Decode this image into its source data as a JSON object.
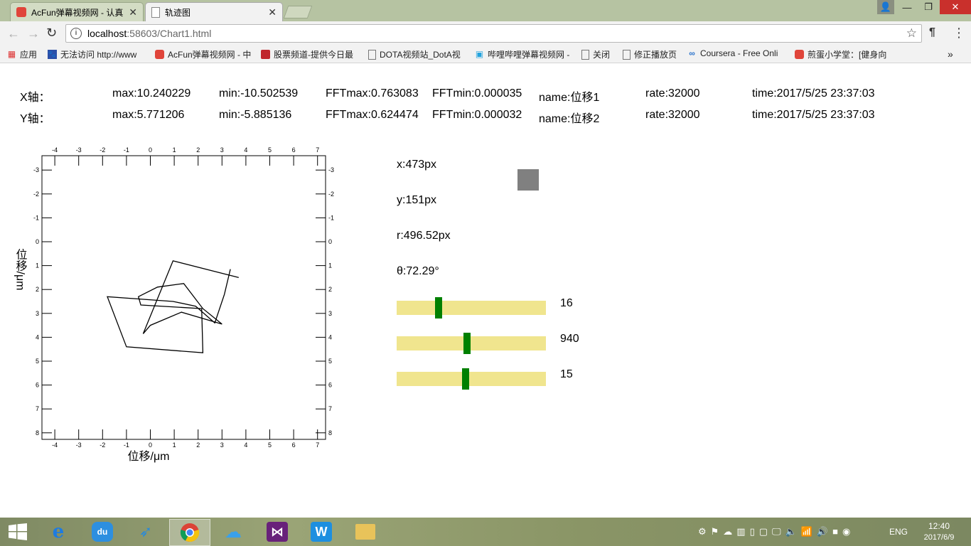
{
  "browser": {
    "tabs": [
      {
        "title": "AcFun弹幕视频网 - 认真"
      },
      {
        "title": "轨迹图"
      }
    ],
    "url_host": "localhost",
    "url_rest": ":58603/Chart1.html",
    "bookmarks": [
      "应用",
      "无法访问 http://www",
      "AcFun弹幕视频网 - 中",
      "股票频道-提供今日最",
      "DOTA视频站_DotA视",
      "哔哩哔哩弹幕视频网 -",
      "关闭",
      "修正播放页",
      "Coursera - Free Onli",
      "煎蛋小学堂：[健身向"
    ],
    "more_bookmarks": "»"
  },
  "info": {
    "x_row": {
      "label": "X轴：",
      "max": "max:10.240229",
      "min": "min:-10.502539",
      "fftmax": "FFTmax:0.763083",
      "fftmin": "FFTmin:0.000035",
      "name": "name:位移1",
      "rate": "rate:32000",
      "time": "time:2017/5/25 23:37:03"
    },
    "y_row": {
      "label": "Y轴：",
      "max": "max:5.771206",
      "min": "min:-5.885136",
      "fftmax": "FFTmax:0.624474",
      "fftmin": "FFTmin:0.000032",
      "name": "name:位移2",
      "rate": "rate:32000",
      "time": "time:2017/5/25 23:37:03"
    }
  },
  "chart_data": {
    "type": "line",
    "xlabel": "位移/μm",
    "ylabel": "位移/μm",
    "xlim": [
      -4.5,
      7.5
    ],
    "ylim": [
      -3.5,
      8.2
    ],
    "y_inverted": true,
    "x_ticks": [
      "-4",
      "-3",
      "-2",
      "-1",
      "0",
      "1",
      "2",
      "3",
      "4",
      "5",
      "6",
      "7"
    ],
    "y_ticks": [
      "-3",
      "-2",
      "-1",
      "0",
      "1",
      "2",
      "3",
      "4",
      "5",
      "6",
      "7",
      "8"
    ],
    "series": [
      {
        "x": [
          3.35,
          3.1,
          2.7,
          1.9,
          0.95,
          -1.8,
          -1.0,
          2.2,
          2.15,
          -0.4,
          -0.5,
          0.3,
          1.4,
          2.2,
          3.0,
          1.3,
          0.0,
          -0.3,
          0.95,
          3.7
        ],
        "y": [
          1.15,
          2.2,
          3.4,
          2.7,
          2.5,
          2.3,
          4.4,
          4.65,
          2.8,
          2.65,
          2.3,
          1.9,
          1.75,
          2.8,
          3.45,
          2.95,
          3.5,
          3.85,
          0.8,
          1.5
        ]
      }
    ]
  },
  "panel": {
    "x": "x:473px",
    "y": "y:151px",
    "r": "r:496.52px",
    "theta": "θ:72.29°",
    "box_color": "#808080"
  },
  "sliders": [
    {
      "value": "16",
      "level": 0.28
    },
    {
      "value": "940",
      "level": 0.47
    },
    {
      "value": "15",
      "level": 0.46
    }
  ],
  "taskbar": {
    "lang": "ENG",
    "time": "12:40",
    "date": "2017/6/9"
  }
}
